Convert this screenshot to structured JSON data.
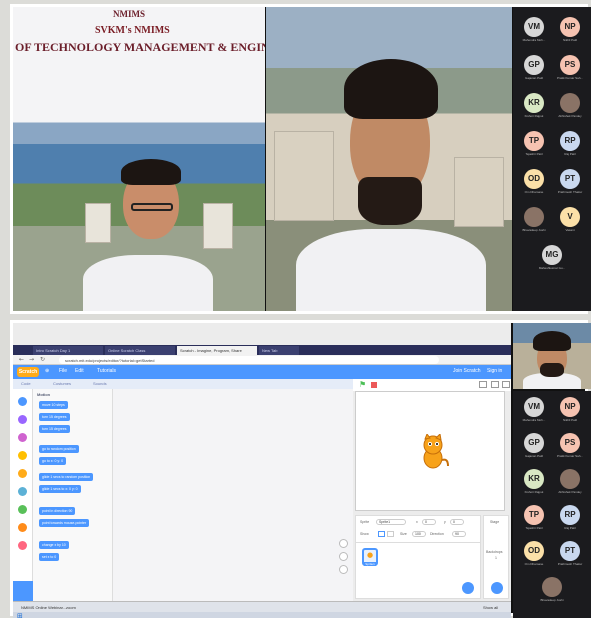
{
  "slide": {
    "logo": "NMIMS",
    "subtitle": "SVKM's NMIMS",
    "title": "OF TECHNOLOGY MANAGEMENT & ENGIN"
  },
  "participants": [
    {
      "initials": "VM",
      "name": "Mahendra Moh...",
      "color": "#d7d7d7"
    },
    {
      "initials": "NP",
      "name": "Nikhil Patil",
      "color": "#f6c3b1"
    },
    {
      "initials": "GP",
      "name": "Gajanan Patil",
      "color": "#d7d7d7"
    },
    {
      "initials": "PS",
      "name": "Pratik Kumar Sah...",
      "color": "#f6c3b1"
    },
    {
      "initials": "KR",
      "name": "Kishori Rajput",
      "color": "#d9e8c4"
    },
    {
      "initials": "",
      "name": "Abhishek Pandey",
      "color": "#8a7366"
    },
    {
      "initials": "TP",
      "name": "Tejashri Patil",
      "color": "#f6c3b1"
    },
    {
      "initials": "RP",
      "name": "Raj Patil",
      "color": "#c9d8ef"
    },
    {
      "initials": "OD",
      "name": "Om Dhamane",
      "color": "#fbe0a8"
    },
    {
      "initials": "PT",
      "name": "Prathmesh Thakur",
      "color": "#c9d8ef"
    },
    {
      "initials": "",
      "name": "Bhavadeep Joshi",
      "color": "#8a7366"
    },
    {
      "initials": "V",
      "name": "Vasant",
      "color": "#fbe0a8"
    },
    {
      "initials": "MG",
      "name": "Maheshkumar Gu...",
      "color": "#d7d7d7"
    }
  ],
  "participants2": [
    {
      "initials": "VM",
      "name": "Mahendra Moh...",
      "color": "#d7d7d7"
    },
    {
      "initials": "NP",
      "name": "Nikhil Patil",
      "color": "#f6c3b1"
    },
    {
      "initials": "GP",
      "name": "Gajanan Patil",
      "color": "#d7d7d7"
    },
    {
      "initials": "PS",
      "name": "Pratik Kumar Sah...",
      "color": "#f6c3b1"
    },
    {
      "initials": "KR",
      "name": "Kishori Rajput",
      "color": "#d9e8c4"
    },
    {
      "initials": "",
      "name": "Abhishek Pandey",
      "color": "#8a7366"
    },
    {
      "initials": "TP",
      "name": "Tejashri Patil",
      "color": "#f6c3b1"
    },
    {
      "initials": "RP",
      "name": "Raj Patil",
      "color": "#c9d8ef"
    },
    {
      "initials": "OD",
      "name": "Om Dhamane",
      "color": "#fbe0a8"
    },
    {
      "initials": "PT",
      "name": "Prathmesh Thakur",
      "color": "#c9d8ef"
    },
    {
      "initials": "",
      "name": "Bhavadeep Joshi",
      "color": "#8a7366"
    }
  ],
  "browser": {
    "tabs": [
      "Intro Scratch Day 1",
      "Online Scratch Class",
      "Scratch - Imagine, Program, Share",
      "New Tab"
    ],
    "url": "scratch.mit.edu/projects/editor/?tutorial=getStarted"
  },
  "scratch": {
    "logo": "Scratch",
    "menu": [
      "File",
      "Edit",
      "Tutorials"
    ],
    "right_menu": [
      "Join Scratch",
      "Sign in"
    ],
    "tabs": [
      "Code",
      "Costumes",
      "Sounds"
    ],
    "category_title": "Motion",
    "blocks": [
      "move 10 steps",
      "turn 15 degrees",
      "turn 15 degrees",
      "go to random position",
      "go to x: 0 y: 0",
      "glide 1 secs to random position",
      "glide 1 secs to x: 0 y: 0",
      "point in direction 90",
      "point towards mouse-pointer",
      "change x by 10",
      "set x to 0"
    ],
    "sprite_label": "Sprite",
    "sprite_name": "Sprite1",
    "x_label": "x",
    "x_value": "0",
    "y_label": "y",
    "y_value": "0",
    "show_label": "Show",
    "size_label": "Size",
    "size_value": "100",
    "direction_label": "Direction",
    "direction_value": "90",
    "stage_label": "Stage",
    "backdrops_label": "Backdrops",
    "backdrops_value": "1",
    "sprite_tile": "Sprite1"
  },
  "taskbar": {
    "item": "NMIMS Online Webinar...zoom",
    "right": "Show all"
  }
}
